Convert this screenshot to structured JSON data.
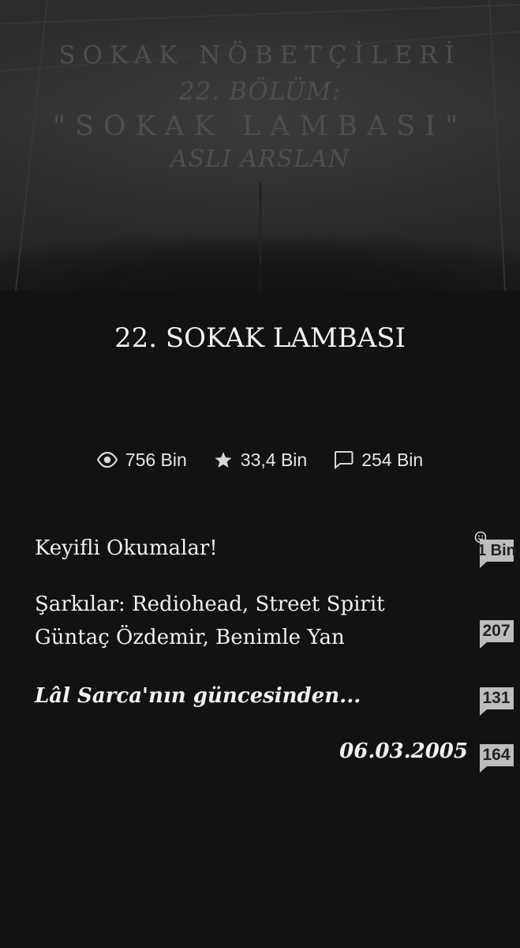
{
  "cover": {
    "lines": [
      "SOKAK NÖBETÇİLERİ",
      "22. BÖLÜM:",
      "\"SOKAK LAMBASI\"",
      "ASLI ARSLAN"
    ]
  },
  "chapter": {
    "title": "22. SOKAK LAMBASI"
  },
  "stats": {
    "reads": {
      "icon": "eye-icon",
      "value": "756 Bin"
    },
    "votes": {
      "icon": "star-icon",
      "value": "33,4 Bin"
    },
    "comments": {
      "icon": "comment-icon",
      "value": "254 Bin"
    }
  },
  "content": {
    "p1": "Keyifli Okumalar!",
    "p2_line1": "Şarkılar: Rediohead, Street Spirit",
    "p2_line2": "Güntaç Özdemir, Benimle Yan",
    "p3": "Lâl Sarca'nın güncesinden...",
    "p4": "06.03.2005"
  },
  "inline_comments": [
    {
      "count": "1 Bin"
    },
    {
      "count": "207"
    },
    {
      "count": "131"
    },
    {
      "count": "164"
    }
  ],
  "colors": {
    "background": "#121212",
    "text": "#ffffff",
    "badge": "#bdbdbd"
  }
}
